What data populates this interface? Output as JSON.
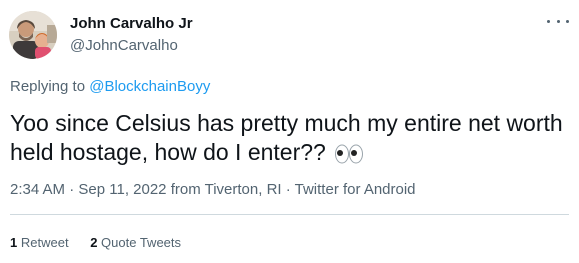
{
  "user": {
    "display_name": "John Carvalho Jr",
    "handle": "@JohnCarvalho"
  },
  "replying_to": {
    "prefix": "Replying to",
    "mention": "@BlockchainBoyy"
  },
  "tweet": {
    "text": "Yoo since Celsius has pretty much my entire net worth held hostage, how do I enter??",
    "emoji": "eyes-emoji"
  },
  "meta": {
    "time": "2:34 AM",
    "date": "Sep 11, 2022",
    "location": "from Tiverton, RI",
    "client": "Twitter for Android"
  },
  "stats": {
    "retweets_count": "1",
    "retweets_label": "Retweet",
    "quotes_count": "2",
    "quotes_label": "Quote Tweets"
  },
  "icons": {
    "more": "more-dots-icon",
    "avatar": "avatar-photo"
  },
  "colors": {
    "link": "#1d9bf0",
    "secondary_text": "#536471",
    "primary_text": "#0f1419",
    "divider": "#cfd9de"
  }
}
